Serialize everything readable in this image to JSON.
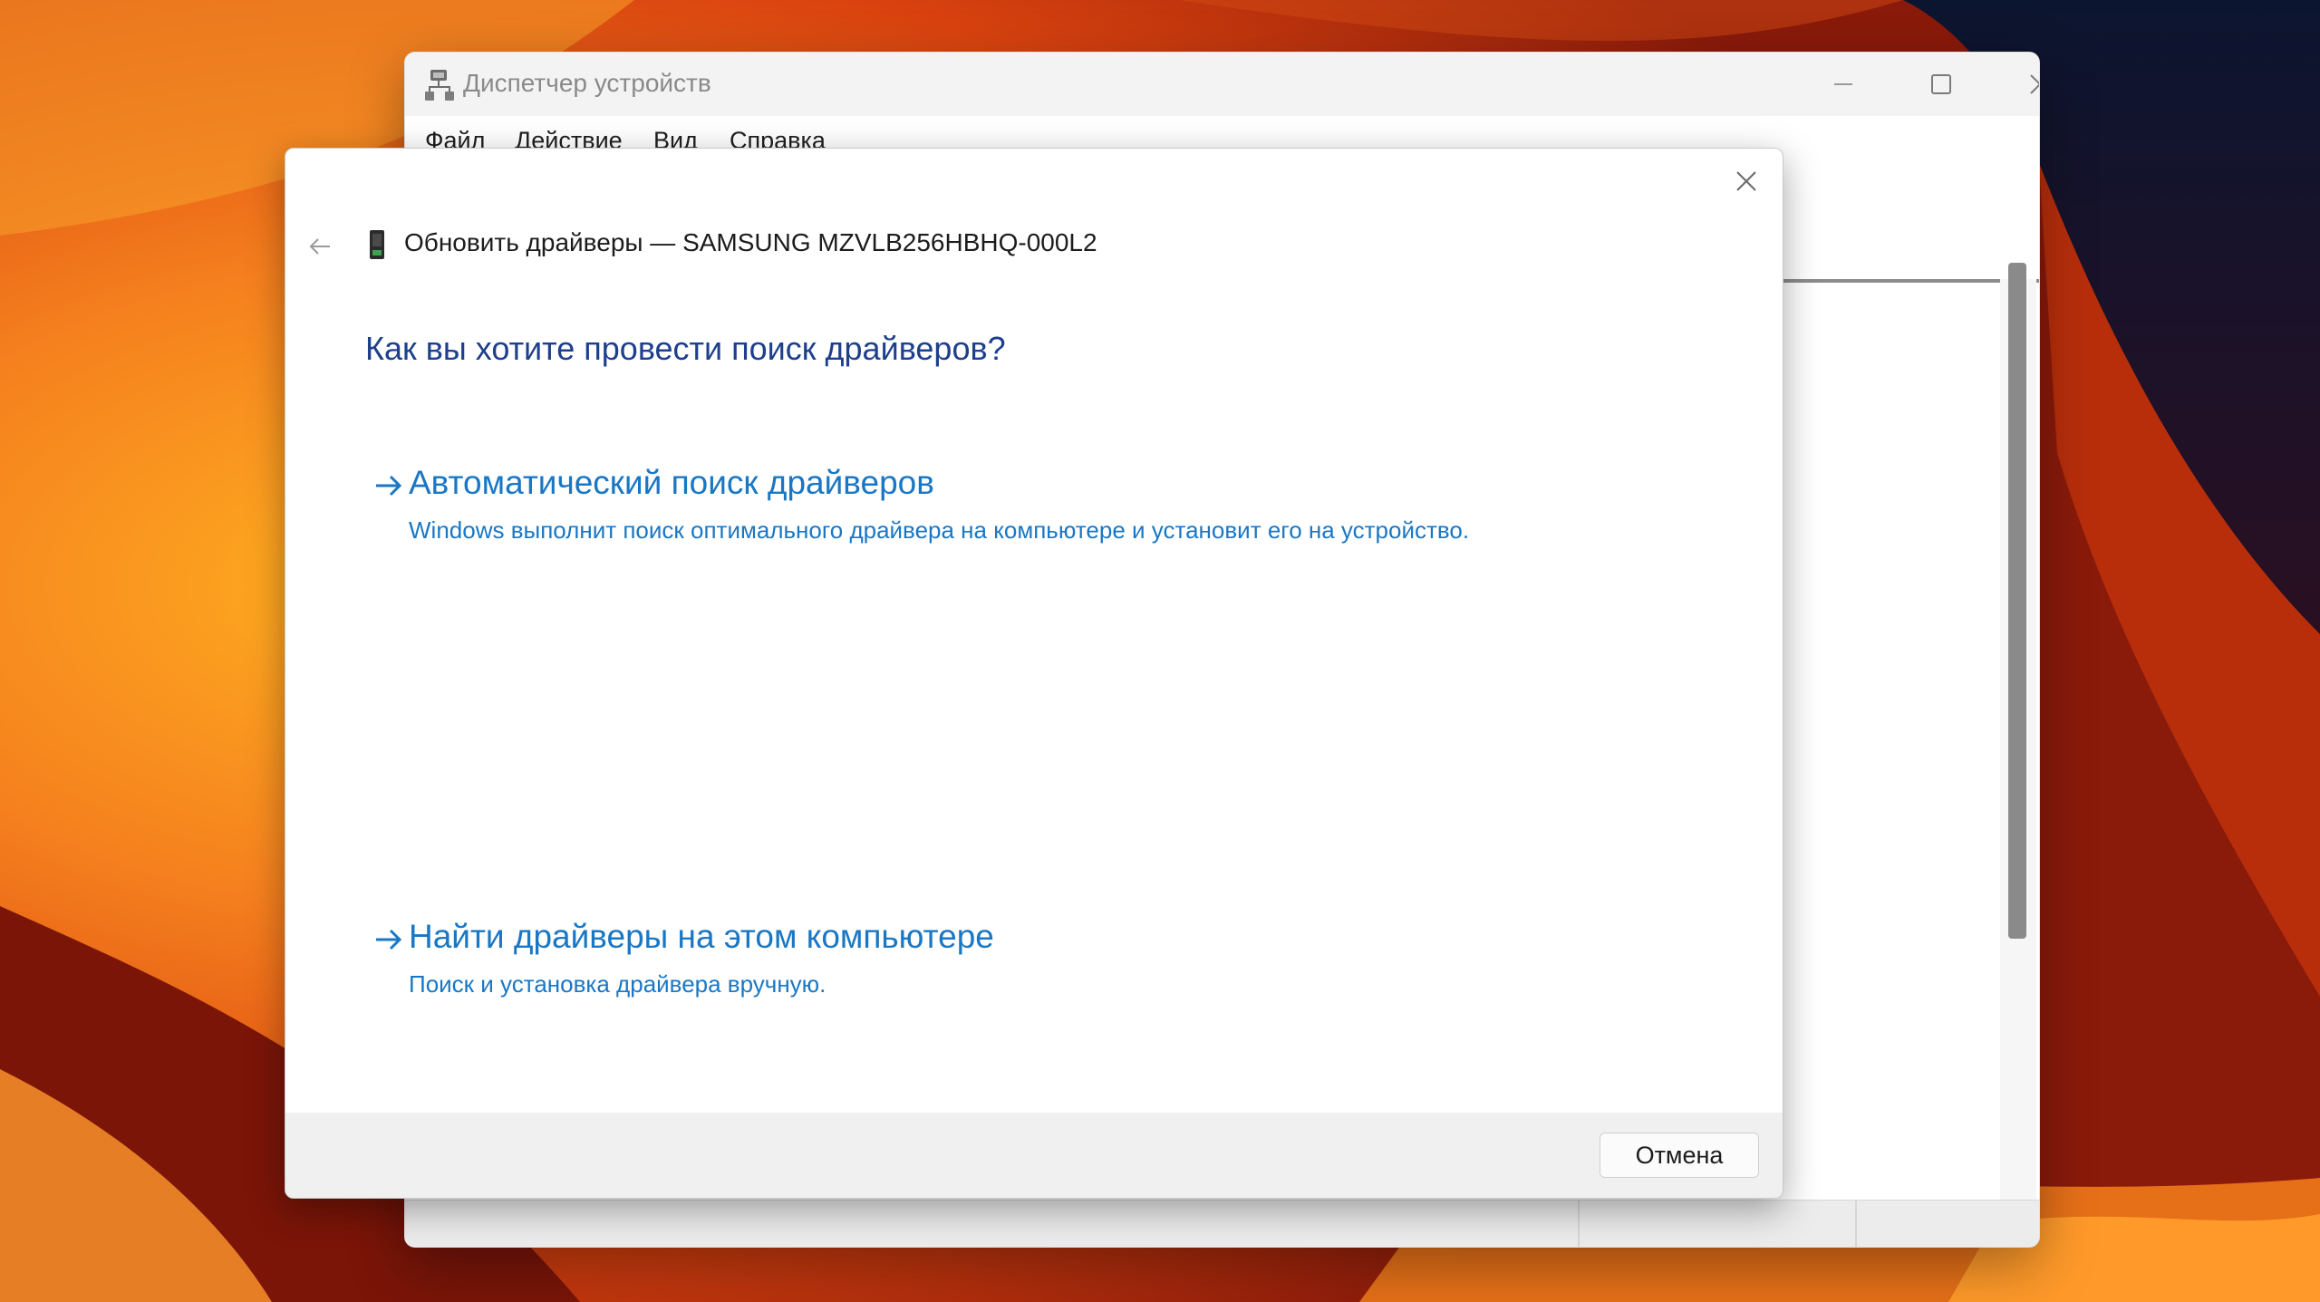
{
  "device_manager": {
    "title": "Диспетчер устройств",
    "menu": [
      "Файл",
      "Действие",
      "Вид",
      "Справка"
    ],
    "window_controls": {
      "minimize_icon": "minimize-icon",
      "maximize_icon": "maximize-icon",
      "close_icon": "close-icon"
    }
  },
  "update_dialog": {
    "header_title": "Обновить драйверы — SAMSUNG MZVLB256HBHQ-000L2",
    "question": "Как вы хотите провести поиск драйверов?",
    "options": [
      {
        "title": "Автоматический поиск драйверов",
        "description": "Windows выполнит поиск оптимального драйвера на компьютере и установит его на устройство."
      },
      {
        "title": "Найти драйверы на этом компьютере",
        "description": "Поиск и установка драйвера вручную."
      }
    ],
    "cancel_label": "Отмена"
  },
  "colors": {
    "link_blue": "#1a77c4",
    "question_blue": "#1d3f8c",
    "wallpaper_orange": "#f06a1c",
    "wallpaper_dark": "#0e1a3a"
  }
}
